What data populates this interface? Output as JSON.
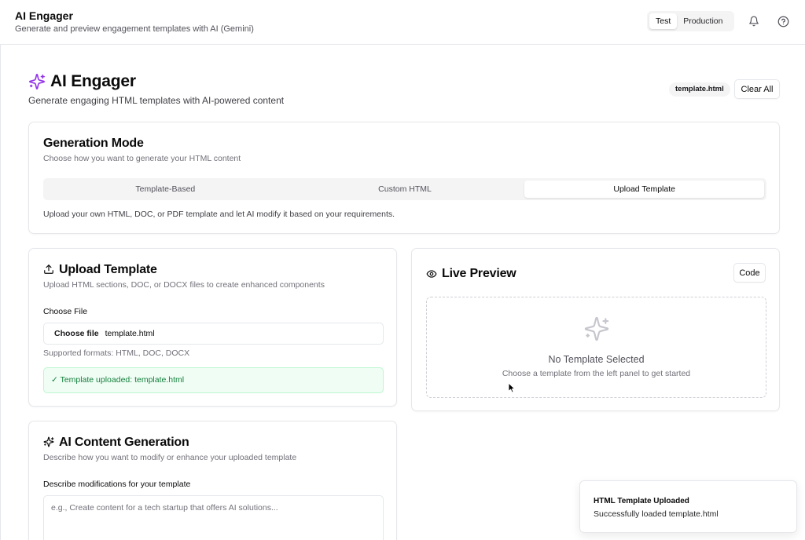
{
  "app": {
    "title": "AI Engager",
    "subtitle": "Generate and preview engagement templates with AI (Gemini)"
  },
  "environment": {
    "options": [
      {
        "label": "Test",
        "selected": true
      },
      {
        "label": "Production",
        "selected": false
      }
    ]
  },
  "header_icons": {
    "notifications": "bell-icon",
    "help": "help-circle-icon"
  },
  "hero": {
    "icon": "sparkles-icon",
    "title": "AI Engager",
    "subtitle": "Generate engaging HTML templates with AI-powered content",
    "file_badge": "template.html",
    "clear_label": "Clear All"
  },
  "generation_mode": {
    "title": "Generation Mode",
    "subtitle": "Choose how you want to generate your HTML content",
    "tabs": [
      {
        "label": "Template-Based",
        "active": false
      },
      {
        "label": "Custom HTML",
        "active": false
      },
      {
        "label": "Upload Template",
        "active": true
      }
    ],
    "description": "Upload your own HTML, DOC, or PDF template and let AI modify it based on your requirements."
  },
  "upload_panel": {
    "icon": "upload-icon",
    "title": "Upload Template",
    "subtitle": "Upload HTML sections, DOC, or DOCX files to create enhanced components",
    "file_label": "Choose File",
    "choose_button": "Choose file",
    "file_name": "template.html",
    "formats_hint": "Supported formats: HTML, DOC, DOCX",
    "success_message": "✓ Template uploaded: template.html"
  },
  "preview_panel": {
    "icon": "eye-icon",
    "title": "Live Preview",
    "code_label": "Code",
    "empty_icon": "sparkles-icon",
    "empty_title": "No Template Selected",
    "empty_hint": "Choose a template from the left panel to get started"
  },
  "ai_panel": {
    "icon": "sparkles-icon",
    "title": "AI Content Generation",
    "subtitle": "Describe how you want to modify or enhance your uploaded template",
    "prompt_label": "Describe modifications for your template",
    "prompt_placeholder": "e.g., Create content for a tech startup that offers AI solutions..."
  },
  "toast": {
    "title": "HTML Template Uploaded",
    "message": "Successfully loaded template.html"
  },
  "colors": {
    "accent": "#9333ea",
    "border": "#e5e7eb",
    "success_bg": "#f0fdf4",
    "success_border": "#bbf7d0",
    "success_text": "#15803d"
  }
}
